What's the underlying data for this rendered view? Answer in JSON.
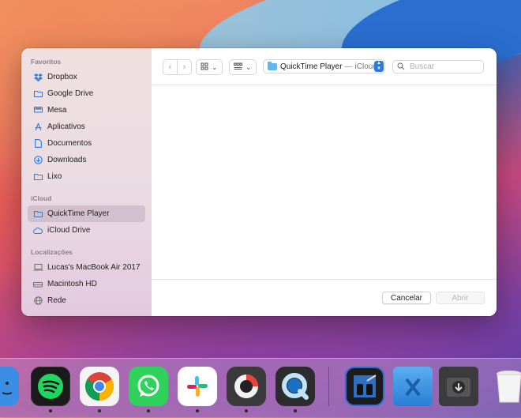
{
  "sidebar": {
    "favorites_header": "Favoritos",
    "favorites": [
      {
        "label": "Dropbox",
        "icon": "dropbox-icon"
      },
      {
        "label": "Google Drive",
        "icon": "folder-icon"
      },
      {
        "label": "Mesa",
        "icon": "desktop-icon"
      },
      {
        "label": "Aplicativos",
        "icon": "applications-icon"
      },
      {
        "label": "Documentos",
        "icon": "document-icon"
      },
      {
        "label": "Downloads",
        "icon": "download-icon"
      },
      {
        "label": "Lixo",
        "icon": "folder-icon"
      }
    ],
    "icloud_header": "iCloud",
    "icloud": [
      {
        "label": "QuickTime Player",
        "icon": "folder-icon",
        "selected": true
      },
      {
        "label": "iCloud Drive",
        "icon": "cloud-icon"
      }
    ],
    "locations_header": "Localizações",
    "locations": [
      {
        "label": "Lucas's MacBook Air 2017",
        "icon": "laptop-icon"
      },
      {
        "label": "Macintosh HD",
        "icon": "hard-drive-icon"
      },
      {
        "label": "Rede",
        "icon": "globe-icon"
      }
    ]
  },
  "toolbar": {
    "location_name": "QuickTime Player",
    "location_separator": "—",
    "location_suffix": "iCloud",
    "search_placeholder": "Buscar"
  },
  "footer": {
    "cancel_label": "Cancelar",
    "open_label": "Abrir"
  },
  "colors": {
    "accent": "#2b7be0",
    "sidebar_selection": "#d8c6d6"
  },
  "dock": {
    "apps": [
      {
        "name": "finder-icon",
        "running": false
      },
      {
        "name": "spotify-icon",
        "running": true
      },
      {
        "name": "chrome-icon",
        "running": true
      },
      {
        "name": "whatsapp-icon",
        "running": true
      },
      {
        "name": "slack-icon",
        "running": true
      },
      {
        "name": "photobooth-icon",
        "running": true
      },
      {
        "name": "quicktime-icon",
        "running": true
      },
      {
        "name": "binoculars-icon",
        "running": false
      },
      {
        "name": "applications-folder-icon",
        "running": false
      },
      {
        "name": "downloads-stack-icon",
        "running": false
      },
      {
        "name": "trash-icon",
        "running": false
      }
    ]
  }
}
